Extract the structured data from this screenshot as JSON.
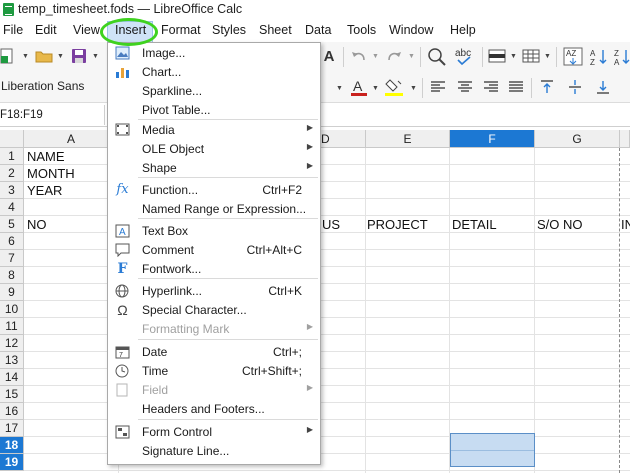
{
  "window": {
    "title": "temp_timesheet.fods — LibreOffice Calc"
  },
  "menubar": {
    "items": [
      "File",
      "Edit",
      "View",
      "Insert",
      "Format",
      "Styles",
      "Sheet",
      "Data",
      "Tools",
      "Window",
      "Help"
    ],
    "active": "Insert"
  },
  "toolbar": {
    "font_name": "Liberation Sans"
  },
  "formula_bar": {
    "name_box": "F18:F19"
  },
  "sheet": {
    "columns": [
      "A",
      "D",
      "E",
      "F",
      "G"
    ],
    "selected_column": "F",
    "rows": [
      "1",
      "2",
      "3",
      "4",
      "5",
      "6",
      "7",
      "8",
      "9",
      "10",
      "11",
      "12",
      "13",
      "14",
      "15",
      "16",
      "17",
      "18",
      "19"
    ],
    "selected_rows": [
      "18",
      "19"
    ],
    "cells": {
      "a1": "NAME",
      "a2": "MONTH",
      "a3": "YEAR",
      "a5": "NO",
      "d5": "US",
      "e5": "PROJECT",
      "f5": "DETAIL",
      "g5": "S/O NO",
      "h5": "IN"
    }
  },
  "insert_menu": {
    "items": [
      {
        "label": "Image...",
        "icon": "image-icon"
      },
      {
        "label": "Chart...",
        "icon": "chart-icon"
      },
      {
        "label": "Sparkline...",
        "icon": ""
      },
      {
        "label": "Pivot Table...",
        "icon": ""
      },
      {
        "label": "Media",
        "icon": "media-icon",
        "submenu": true
      },
      {
        "label": "OLE Object",
        "icon": "",
        "submenu": true
      },
      {
        "label": "Shape",
        "icon": "",
        "submenu": true
      },
      {
        "label": "Function...",
        "icon": "function-icon",
        "shortcut": "Ctrl+F2"
      },
      {
        "label": "Named Range or Expression...",
        "icon": ""
      },
      {
        "label": "Text Box",
        "icon": "text-box-icon"
      },
      {
        "label": "Comment",
        "icon": "comment-icon",
        "shortcut": "Ctrl+Alt+C"
      },
      {
        "label": "Fontwork...",
        "icon": "fontwork-icon"
      },
      {
        "label": "Hyperlink...",
        "icon": "hyperlink-icon",
        "shortcut": "Ctrl+K"
      },
      {
        "label": "Special Character...",
        "icon": "special-character-icon"
      },
      {
        "label": "Formatting Mark",
        "icon": "",
        "submenu": true,
        "disabled": true
      },
      {
        "label": "Date",
        "icon": "calendar-icon",
        "shortcut": "Ctrl+;"
      },
      {
        "label": "Time",
        "icon": "clock-icon",
        "shortcut": "Ctrl+Shift+;"
      },
      {
        "label": "Field",
        "icon": "field-icon",
        "submenu": true,
        "disabled": true
      },
      {
        "label": "Headers and Footers...",
        "icon": ""
      },
      {
        "label": "Form Control",
        "icon": "form-control-icon",
        "submenu": true
      },
      {
        "label": "Signature Line...",
        "icon": ""
      }
    ]
  }
}
